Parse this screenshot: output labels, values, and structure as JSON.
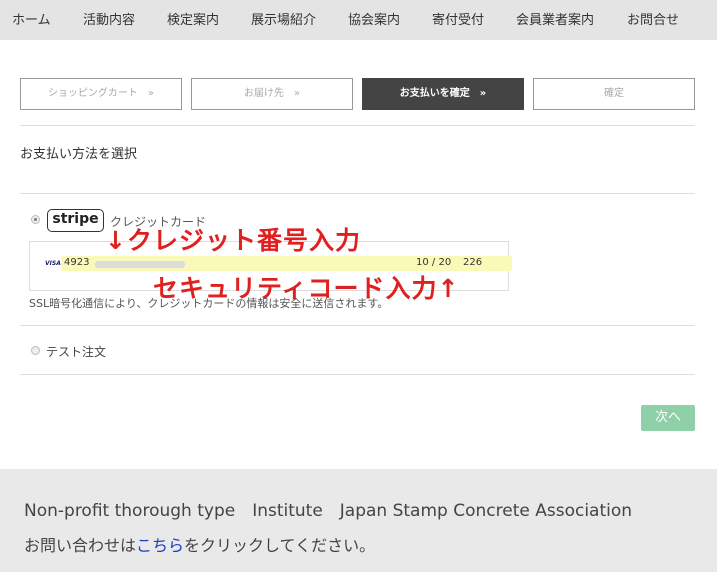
{
  "nav": {
    "items": [
      "ホーム",
      "活動内容",
      "検定案内",
      "展示場紹介",
      "協会案内",
      "寄付受付",
      "会員業者案内",
      "お問合せ"
    ]
  },
  "steps": [
    {
      "label": "ショッピングカート　»"
    },
    {
      "label": "お届け先　»"
    },
    {
      "label": "お支払いを確定　»"
    },
    {
      "label": "確定"
    }
  ],
  "payment": {
    "section_title": "お支払い方法を選択",
    "stripe_logo": "stripe",
    "credit_card_label": "クレジットカード",
    "card_brand": "VISA",
    "card_number_visible": "4923",
    "expiry": "10 / 20",
    "cvc": "226",
    "ssl_note": "SSL暗号化通信により、クレジットカードの情報は安全に送信されます。",
    "test_order_label": "テスト注文"
  },
  "annotations": {
    "card_number": "↓クレジット番号入力",
    "security_code": "セキュリティコード入力↑"
  },
  "next_button": "次へ",
  "footer": {
    "line1": "Non-profit thorough type　Institute　Japan Stamp Concrete Association",
    "line2_before": "お問い合わせは",
    "line2_link": "こちら",
    "line2_after": "をクリックしてください。"
  },
  "colors": {
    "annotation": "#e02020",
    "active_step": "#444444",
    "next_button": "#8fd0a8",
    "link": "#1a3ec8",
    "field_highlight": "#fafab8"
  }
}
